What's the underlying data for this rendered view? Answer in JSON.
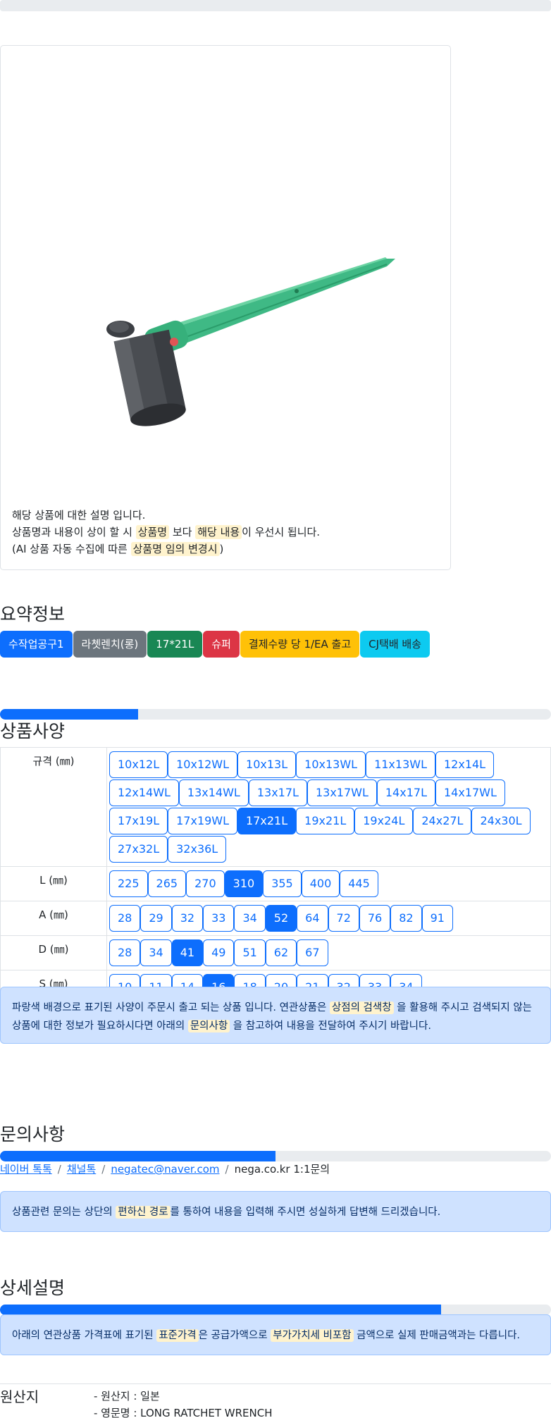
{
  "product_image": {
    "description_lines": [
      {
        "text": "해당 상품에 대한 설명 입니다."
      },
      {
        "pre": "상품명과 내용이 상이 할 시 ",
        "hl1": "상품명",
        "mid": " 보다 ",
        "hl2": "해당 내용",
        "post": "이 우선시 됩니다."
      },
      {
        "pre": "(AI 상품 자동 수집에 따른 ",
        "hl1": "상품명 임의 변경시",
        "post": ")"
      }
    ]
  },
  "summary": {
    "title": "요약정보",
    "badges": [
      {
        "label": "수작업공구1",
        "bg": "#0d6efd",
        "fg": "#ffffff"
      },
      {
        "label": "라쳇렌치(롱)",
        "bg": "#6c757d",
        "fg": "#ffffff"
      },
      {
        "label": "17*21L",
        "bg": "#198754",
        "fg": "#ffffff"
      },
      {
        "label": "슈퍼",
        "bg": "#dc3545",
        "fg": "#ffffff"
      },
      {
        "label": "결제수량 당 1/EA 출고",
        "bg": "#ffc107",
        "fg": "#212529"
      },
      {
        "label": "CJ택배 배송",
        "bg": "#0dcaf0",
        "fg": "#212529"
      }
    ]
  },
  "spec": {
    "title": "상품사양",
    "progress": 0.25,
    "rows": [
      {
        "label": "규격 (㎜)",
        "options": [
          "10x12L",
          "10x12WL",
          "10x13L",
          "10x13WL",
          "11x13WL",
          "12x14L",
          "12x14WL",
          "13x14WL",
          "13x17L",
          "13x17WL",
          "14x17L",
          "14x17WL",
          "17x19L",
          "17x19WL",
          "17x21L",
          "19x21L",
          "19x24L",
          "24x27L",
          "24x30L",
          "27x32L",
          "32x36L"
        ],
        "selected": "17x21L"
      },
      {
        "label": "L (㎜)",
        "options": [
          "225",
          "265",
          "270",
          "310",
          "355",
          "400",
          "445"
        ],
        "selected": "310"
      },
      {
        "label": "A (㎜)",
        "options": [
          "28",
          "29",
          "32",
          "33",
          "34",
          "52",
          "64",
          "72",
          "76",
          "82",
          "91"
        ],
        "selected": "52"
      },
      {
        "label": "D (㎜)",
        "options": [
          "28",
          "34",
          "41",
          "49",
          "51",
          "62",
          "67"
        ],
        "selected": "41"
      },
      {
        "label": "S (㎜)",
        "options": [
          "10",
          "11",
          "14",
          "16",
          "18",
          "20",
          "21",
          "32",
          "33",
          "34"
        ],
        "selected": "16"
      }
    ],
    "notice": {
      "pre": "파랑색 배경으로 표기된 사양이 주문시 출고 되는 상품 입니다. 연관상품은 ",
      "hl1": "상점의 검색창",
      "mid": " 을 활용해 주시고 검색되지 않는 상품에 대한 정보가 필요하시다면 아래의 ",
      "hl2": "문의사항",
      "post": " 을 참고하여 내용을 전달하여 주시기 바랍니다."
    }
  },
  "inquiry": {
    "title": "문의사항",
    "progress": 0.5,
    "links": [
      "네이버 톡톡",
      "채널톡",
      "negatec@naver.com"
    ],
    "plain": "nega.co.kr 1:1문의",
    "notice": {
      "pre": "상품관련 문의는 상단의 ",
      "hl1": "편하신 경로",
      "post": "를 통하여 내용을 입력해 주시면 성실하게 답변해 드리겠습니다."
    }
  },
  "detail": {
    "title": "상세설명",
    "progress": 0.8,
    "notice": {
      "pre": "아래의 연관상품 가격표에 표기된 ",
      "hl1": "표준가격",
      "mid": "은 공급가액으로 ",
      "hl2": "부가가치세 비포함",
      "post": " 금액으로 실제 판매금액과는 다릅니다."
    }
  },
  "origin": {
    "label": "원산지",
    "items": [
      "- 원산지 : 일본",
      "- 영문명 : LONG RATCHET WRENCH"
    ]
  }
}
